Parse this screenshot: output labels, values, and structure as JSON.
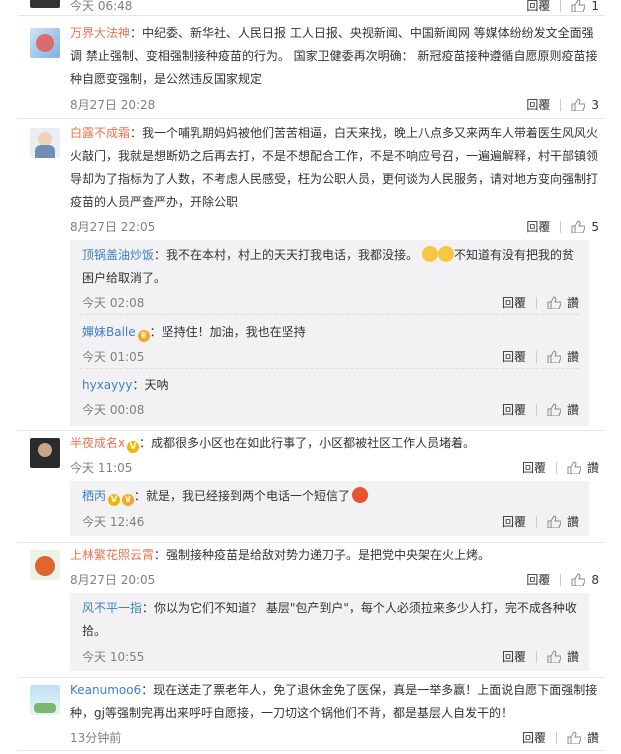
{
  "top_partial": {
    "time": "今天 06:48",
    "reply": "回覆",
    "likes": "1"
  },
  "comments": [
    {
      "user": "万界大法神",
      "text": "：中纪委、新华社、人民日报 工人日报、央视新闻、中国新闻网 等媒体纷纷发文全面强调 禁止强制、变相强制接种疫苗的行为。 国家卫健委再次明确： 新冠疫苗接种遵循自愿原则疫苗接种自愿变强制，是公然违反国家规定",
      "time": "8月27日 20:28",
      "reply": "回覆",
      "likes": "3"
    },
    {
      "user": "白露不成霜",
      "text": "：我一个哺乳期妈妈被他们苦苦相逼，白天来找，晚上八点多又来两车人带着医生风风火火敲门，我就是想断奶之后再去打，不是不想配合工作，不是不响应号召，一遍遍解释，村干部镇领导却为了指标为了人数，不考虑人民感受，枉为公职人员，更何谈为人民服务，请对地方变向强制打疫苗的人员严查严办，开除公职",
      "time": "8月27日 22:05",
      "reply": "回覆",
      "likes": "5",
      "replies": [
        {
          "user": "顶锅盖油炒饭",
          "text": "：我不在本村，村上的天天打我电话，我都没接。",
          "text2": "不知道有没有把我的贫困户给取消了。",
          "time": "今天 02:08",
          "reply": "回覆",
          "like": "讚"
        },
        {
          "user": "嬋妹Balle",
          "text": "：坚持住！加油，我也在坚持",
          "time": "今天 01:05",
          "reply": "回覆",
          "like": "讚"
        },
        {
          "user": "hyxayyy",
          "text": "：天呐",
          "time": "今天 00:08",
          "reply": "回覆",
          "like": "讚"
        }
      ]
    },
    {
      "user": "半夜成名x",
      "text": "：成都很多小区也在如此行事了，小区都被社区工作人员堵着。",
      "time": "今天 11:05",
      "reply": "回覆",
      "like": "讚",
      "replies": [
        {
          "user": "栖丙",
          "text": "：就是，我已经接到两个电话一个短信了",
          "time": "今天 12:46",
          "reply": "回覆",
          "like": "讚"
        }
      ]
    },
    {
      "user": "上林繁花照云霄",
      "text": "：强制接种疫苗是给敌对势力递刀子。是把党中央架在火上烤。",
      "time": "8月27日 20:05",
      "reply": "回覆",
      "likes": "8",
      "replies": [
        {
          "user": "风不平一指",
          "text": "：你以为它们不知道？ 基层\"包产到户\"，每个人必须拉来多少人打，完不成各种收拾。",
          "time": "今天 10:55",
          "reply": "回覆",
          "like": "讚"
        }
      ]
    },
    {
      "user": "Keanumoo6",
      "text": "：现在送走了票老年人，免了退休金免了医保，真是一举多赢！上面说自愿下面强制接种，gj等强制完再出来呼吁自愿接，一刀切这个锅他们不背，都是基层人自发干的！",
      "time": "13分钟前",
      "reply": "回覆",
      "like": "讚"
    }
  ],
  "colors": {
    "username": "#eb7350",
    "reply_username": "#3f7fc1",
    "meta": "#808080",
    "reply_bg": "#f2f2f5"
  }
}
